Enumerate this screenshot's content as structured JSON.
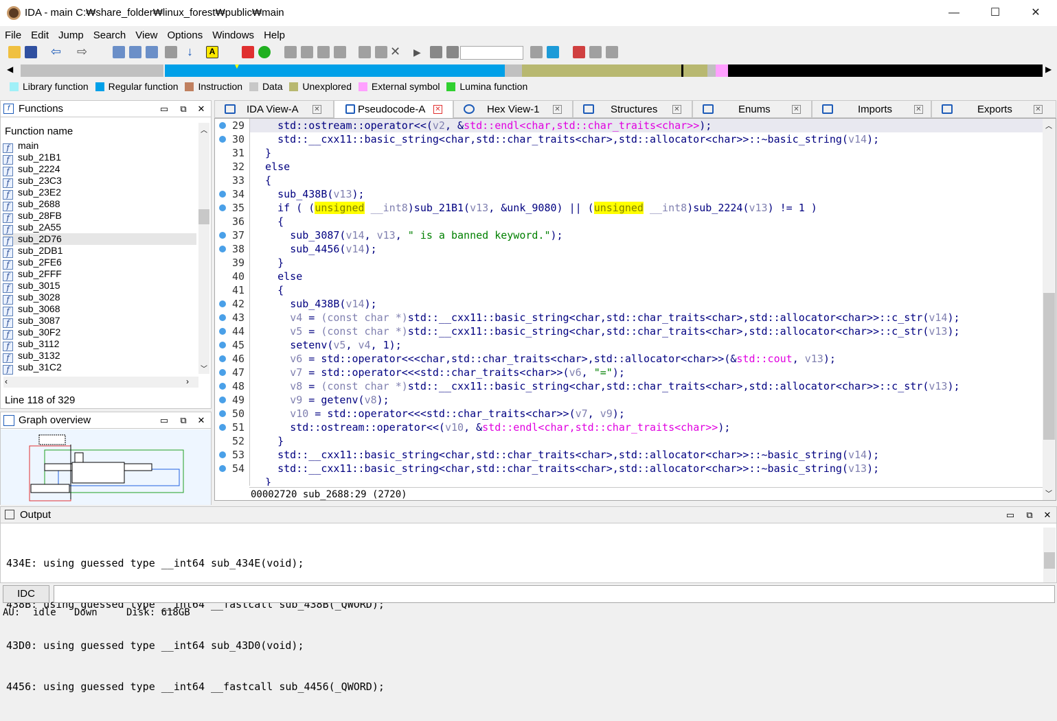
{
  "window": {
    "title": "IDA - main C:₩share_folder₩linux_forest₩public₩main",
    "minimize": "—",
    "maximize": "☐",
    "close": "✕"
  },
  "menu": [
    "File",
    "Edit",
    "Jump",
    "Search",
    "View",
    "Options",
    "Windows",
    "Help"
  ],
  "legend": [
    {
      "label": "Library function",
      "color": "#a0f0f8"
    },
    {
      "label": "Regular function",
      "color": "#00a0e8"
    },
    {
      "label": "Instruction",
      "color": "#c08060"
    },
    {
      "label": "Data",
      "color": "#c8c8c8"
    },
    {
      "label": "Unexplored",
      "color": "#b8b870"
    },
    {
      "label": "External symbol",
      "color": "#ffa0ff"
    },
    {
      "label": "Lumina function",
      "color": "#30d030"
    }
  ],
  "functions_panel": {
    "title": "Functions",
    "column": "Function name",
    "items": [
      "main",
      "sub_21B1",
      "sub_2224",
      "sub_23C3",
      "sub_23E2",
      "sub_2688",
      "sub_28FB",
      "sub_2A55",
      "sub_2D76",
      "sub_2DB1",
      "sub_2FE6",
      "sub_2FFF",
      "sub_3015",
      "sub_3028",
      "sub_3068",
      "sub_3087",
      "sub_30F2",
      "sub_3112",
      "sub_3132",
      "sub_31C2"
    ],
    "selected_index": 8,
    "line_info": "Line 118 of 329"
  },
  "graph_panel": {
    "title": "Graph overview"
  },
  "tabs": [
    {
      "label": "IDA View-A",
      "active": false
    },
    {
      "label": "Pseudocode-A",
      "active": true
    },
    {
      "label": "Hex View-1",
      "active": false
    },
    {
      "label": "Structures",
      "active": false
    },
    {
      "label": "Enums",
      "active": false
    },
    {
      "label": "Imports",
      "active": false
    },
    {
      "label": "Exports",
      "active": false
    }
  ],
  "code": {
    "line_numbers": [
      "29",
      "30",
      "31",
      "32",
      "33",
      "34",
      "35",
      "36",
      "37",
      "38",
      "39",
      "40",
      "41",
      "42",
      "43",
      "44",
      "45",
      "46",
      "47",
      "48",
      "49",
      "50",
      "51",
      "52",
      "53",
      "54"
    ],
    "status": "00002720 sub_2688:29 (2720)"
  },
  "output": {
    "title": "Output",
    "lines": [
      "434E: using guessed type __int64 sub_434E(void);",
      "438B: using guessed type __int64 __fastcall sub_438B(_QWORD);",
      "43D0: using guessed type __int64 sub_43D0(void);",
      "4456: using guessed type __int64 __fastcall sub_4456(_QWORD);"
    ]
  },
  "idc": {
    "label": "IDC"
  },
  "statusbar": {
    "au": "AU:",
    "state": "idle",
    "direction": "Down",
    "disk": "Disk: 618GB"
  }
}
